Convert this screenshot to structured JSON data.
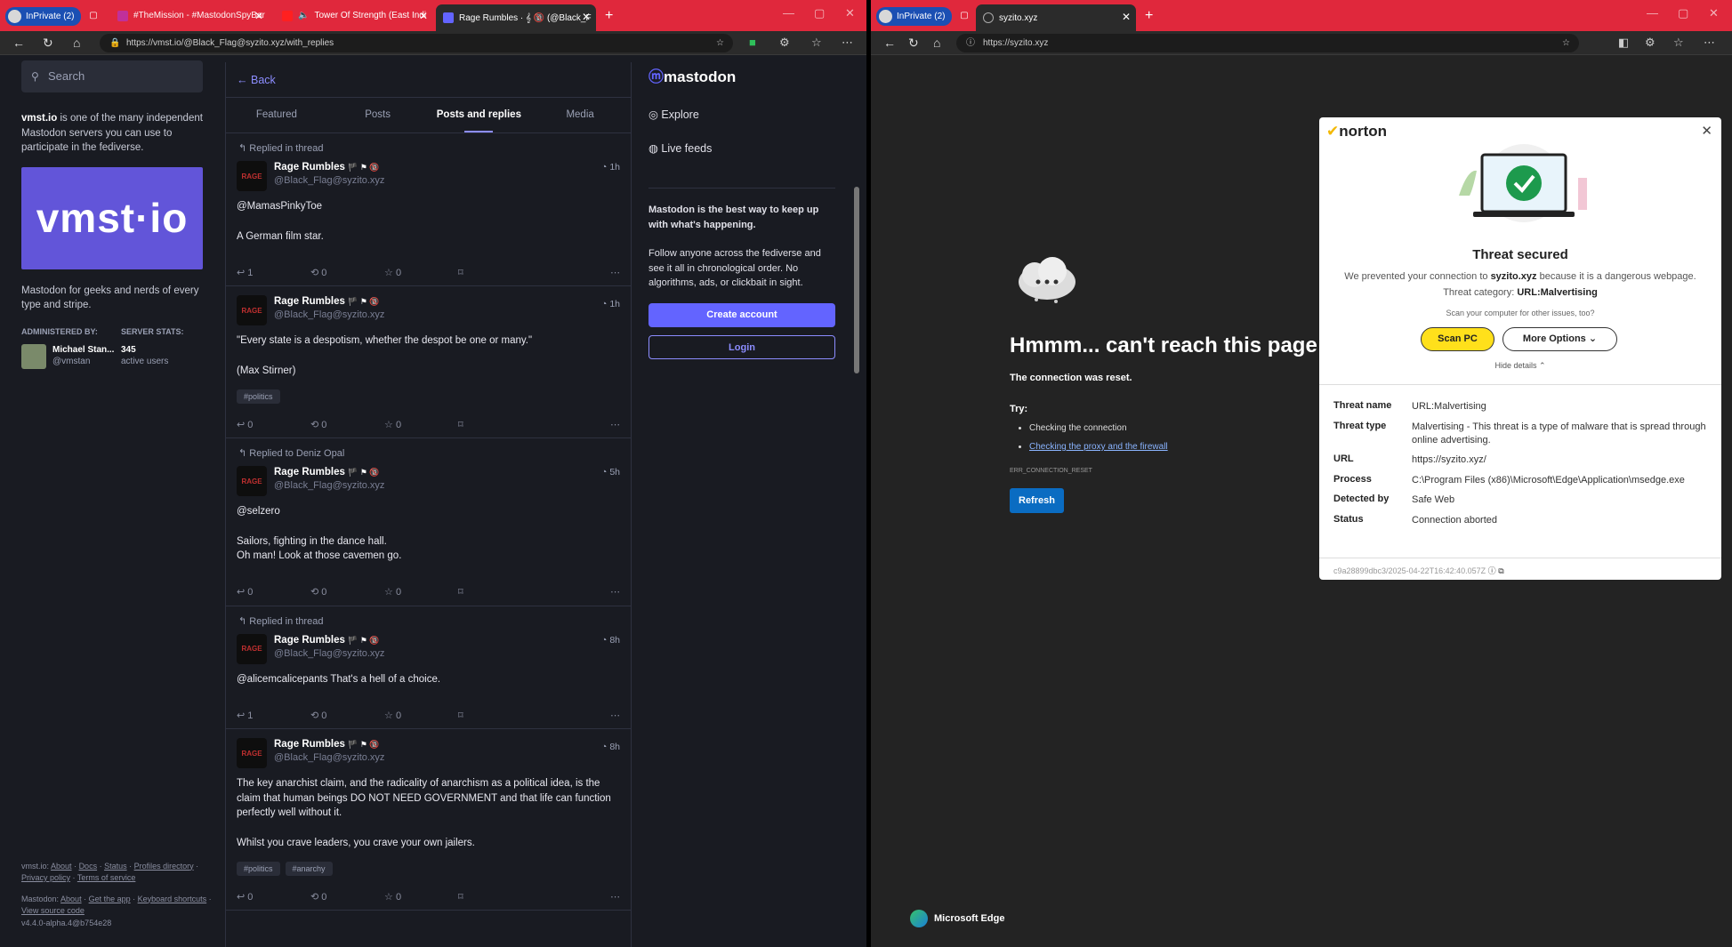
{
  "left_browser": {
    "tabs": [
      {
        "label": "InPrivate (2)"
      },
      {
        "label": "#TheMission - #MastodonSpyBar"
      },
      {
        "label": "Tower Of Strength (East Indi"
      },
      {
        "label": "Rage Rumbles · 𝄞 🔞 (@Black_F"
      }
    ],
    "url": "https://vmst.io/@Black_Flag@syzito.xyz/with_replies"
  },
  "sidebar": {
    "search_placeholder": "Search",
    "about_bold": "vmst.io",
    "about_rest": " is one of the many independent Mastodon servers you can use to participate in the fediverse.",
    "banner_text": "vmst·io",
    "tagline": "Mastodon for geeks and nerds of every type and stripe.",
    "administered_by": "ADMINISTERED BY:",
    "server_stats": "SERVER STATS:",
    "admin_name": "Michael Stan...",
    "admin_handle": "@vmstan",
    "active_users_count": "345",
    "active_users_label": "active users",
    "footer": {
      "line1": [
        "vmst.io:",
        "About",
        "Docs",
        "Status",
        "Profiles directory",
        "Privacy policy",
        "Terms of service"
      ],
      "line2": [
        "Mastodon:",
        "About",
        "Get the app",
        "Keyboard shortcuts",
        "View source code"
      ],
      "version": "v4.4.0-alpha.4@b754e28"
    }
  },
  "feed": {
    "back_label": "Back",
    "tabs": [
      "Featured",
      "Posts",
      "Posts and replies",
      "Media"
    ],
    "posts": [
      {
        "context": "Replied in thread",
        "name": "Rage Rumbles",
        "handle": "@Black_Flag@syzito.xyz",
        "time": "1h",
        "lines": [
          "@MamasPinkyToe",
          "A German film star."
        ],
        "tags": [],
        "replies": "1",
        "boosts": "0",
        "favs": "0"
      },
      {
        "context": "",
        "name": "Rage Rumbles",
        "handle": "@Black_Flag@syzito.xyz",
        "time": "1h",
        "lines": [
          "\"Every state is a despotism, whether the despot be one or many.\"",
          "(Max Stirner)"
        ],
        "tags": [
          "#politics"
        ],
        "replies": "0",
        "boosts": "0",
        "favs": "0"
      },
      {
        "context": "Replied to Deniz Opal",
        "name": "Rage Rumbles",
        "handle": "@Black_Flag@syzito.xyz",
        "time": "5h",
        "lines": [
          "@selzero",
          "Sailors, fighting in the dance hall.\nOh man! Look at those cavemen go."
        ],
        "tags": [],
        "replies": "0",
        "boosts": "0",
        "favs": "0"
      },
      {
        "context": "Replied in thread",
        "name": "Rage Rumbles",
        "handle": "@Black_Flag@syzito.xyz",
        "time": "8h",
        "lines": [
          "@alicemcalicepants That's a hell of a choice."
        ],
        "tags": [],
        "replies": "1",
        "boosts": "0",
        "favs": "0"
      },
      {
        "context": "",
        "name": "Rage Rumbles",
        "handle": "@Black_Flag@syzito.xyz",
        "time": "8h",
        "lines": [
          "The key anarchist claim, and the radicality of anarchism as a political idea, is the claim that human beings DO NOT NEED GOVERNMENT and that life can function perfectly well without it.",
          "Whilst you crave leaders, you crave your own jailers."
        ],
        "tags": [
          "#politics",
          "#anarchy"
        ],
        "replies": "0",
        "boosts": "0",
        "favs": "0"
      }
    ]
  },
  "right_panel": {
    "logo": "mastodon",
    "explore": "Explore",
    "live_feeds": "Live feeds",
    "pitch_bold": "Mastodon is the best way to keep up with what's happening.",
    "pitch": "Follow anyone across the fediverse and see it all in chronological order. No algorithms, ads, or clickbait in sight.",
    "create_account": "Create account",
    "login": "Login"
  },
  "right_browser": {
    "tabs": [
      {
        "label": "InPrivate (2)"
      },
      {
        "label": "syzito.xyz"
      }
    ],
    "url": "https://syzito.xyz"
  },
  "error_page": {
    "title": "Hmmm... can't reach this page",
    "subtitle": "The connection was reset.",
    "try": "Try:",
    "items": [
      "Checking the connection",
      "Checking the proxy and the firewall"
    ],
    "code": "ERR_CONNECTION_RESET",
    "refresh": "Refresh",
    "brand": "Microsoft Edge"
  },
  "norton": {
    "logo": "norton",
    "headline": "Threat secured",
    "desc_pre": "We prevented your connection to ",
    "desc_site": "syzito.xyz",
    "desc_mid": " because it is a dangerous webpage. Threat category: ",
    "desc_cat": "URL:Malvertising",
    "scan_prompt": "Scan your computer for other issues, too?",
    "scan_btn": "Scan PC",
    "more_btn": "More Options",
    "hide": "Hide details",
    "details": [
      {
        "k": "Threat name",
        "v": "URL:Malvertising"
      },
      {
        "k": "Threat type",
        "v": "Malvertising - This threat is a type of malware that is spread through online advertising."
      },
      {
        "k": "URL",
        "v": "https://syzito.xyz/"
      },
      {
        "k": "Process",
        "v": "C:\\Program Files (x86)\\Microsoft\\Edge\\Application\\msedge.exe"
      },
      {
        "k": "Detected by",
        "v": "Safe Web"
      },
      {
        "k": "Status",
        "v": "Connection aborted"
      }
    ],
    "footer_id": "c9a28899dbc3/2025-04-22T16:42:40.057Z"
  }
}
